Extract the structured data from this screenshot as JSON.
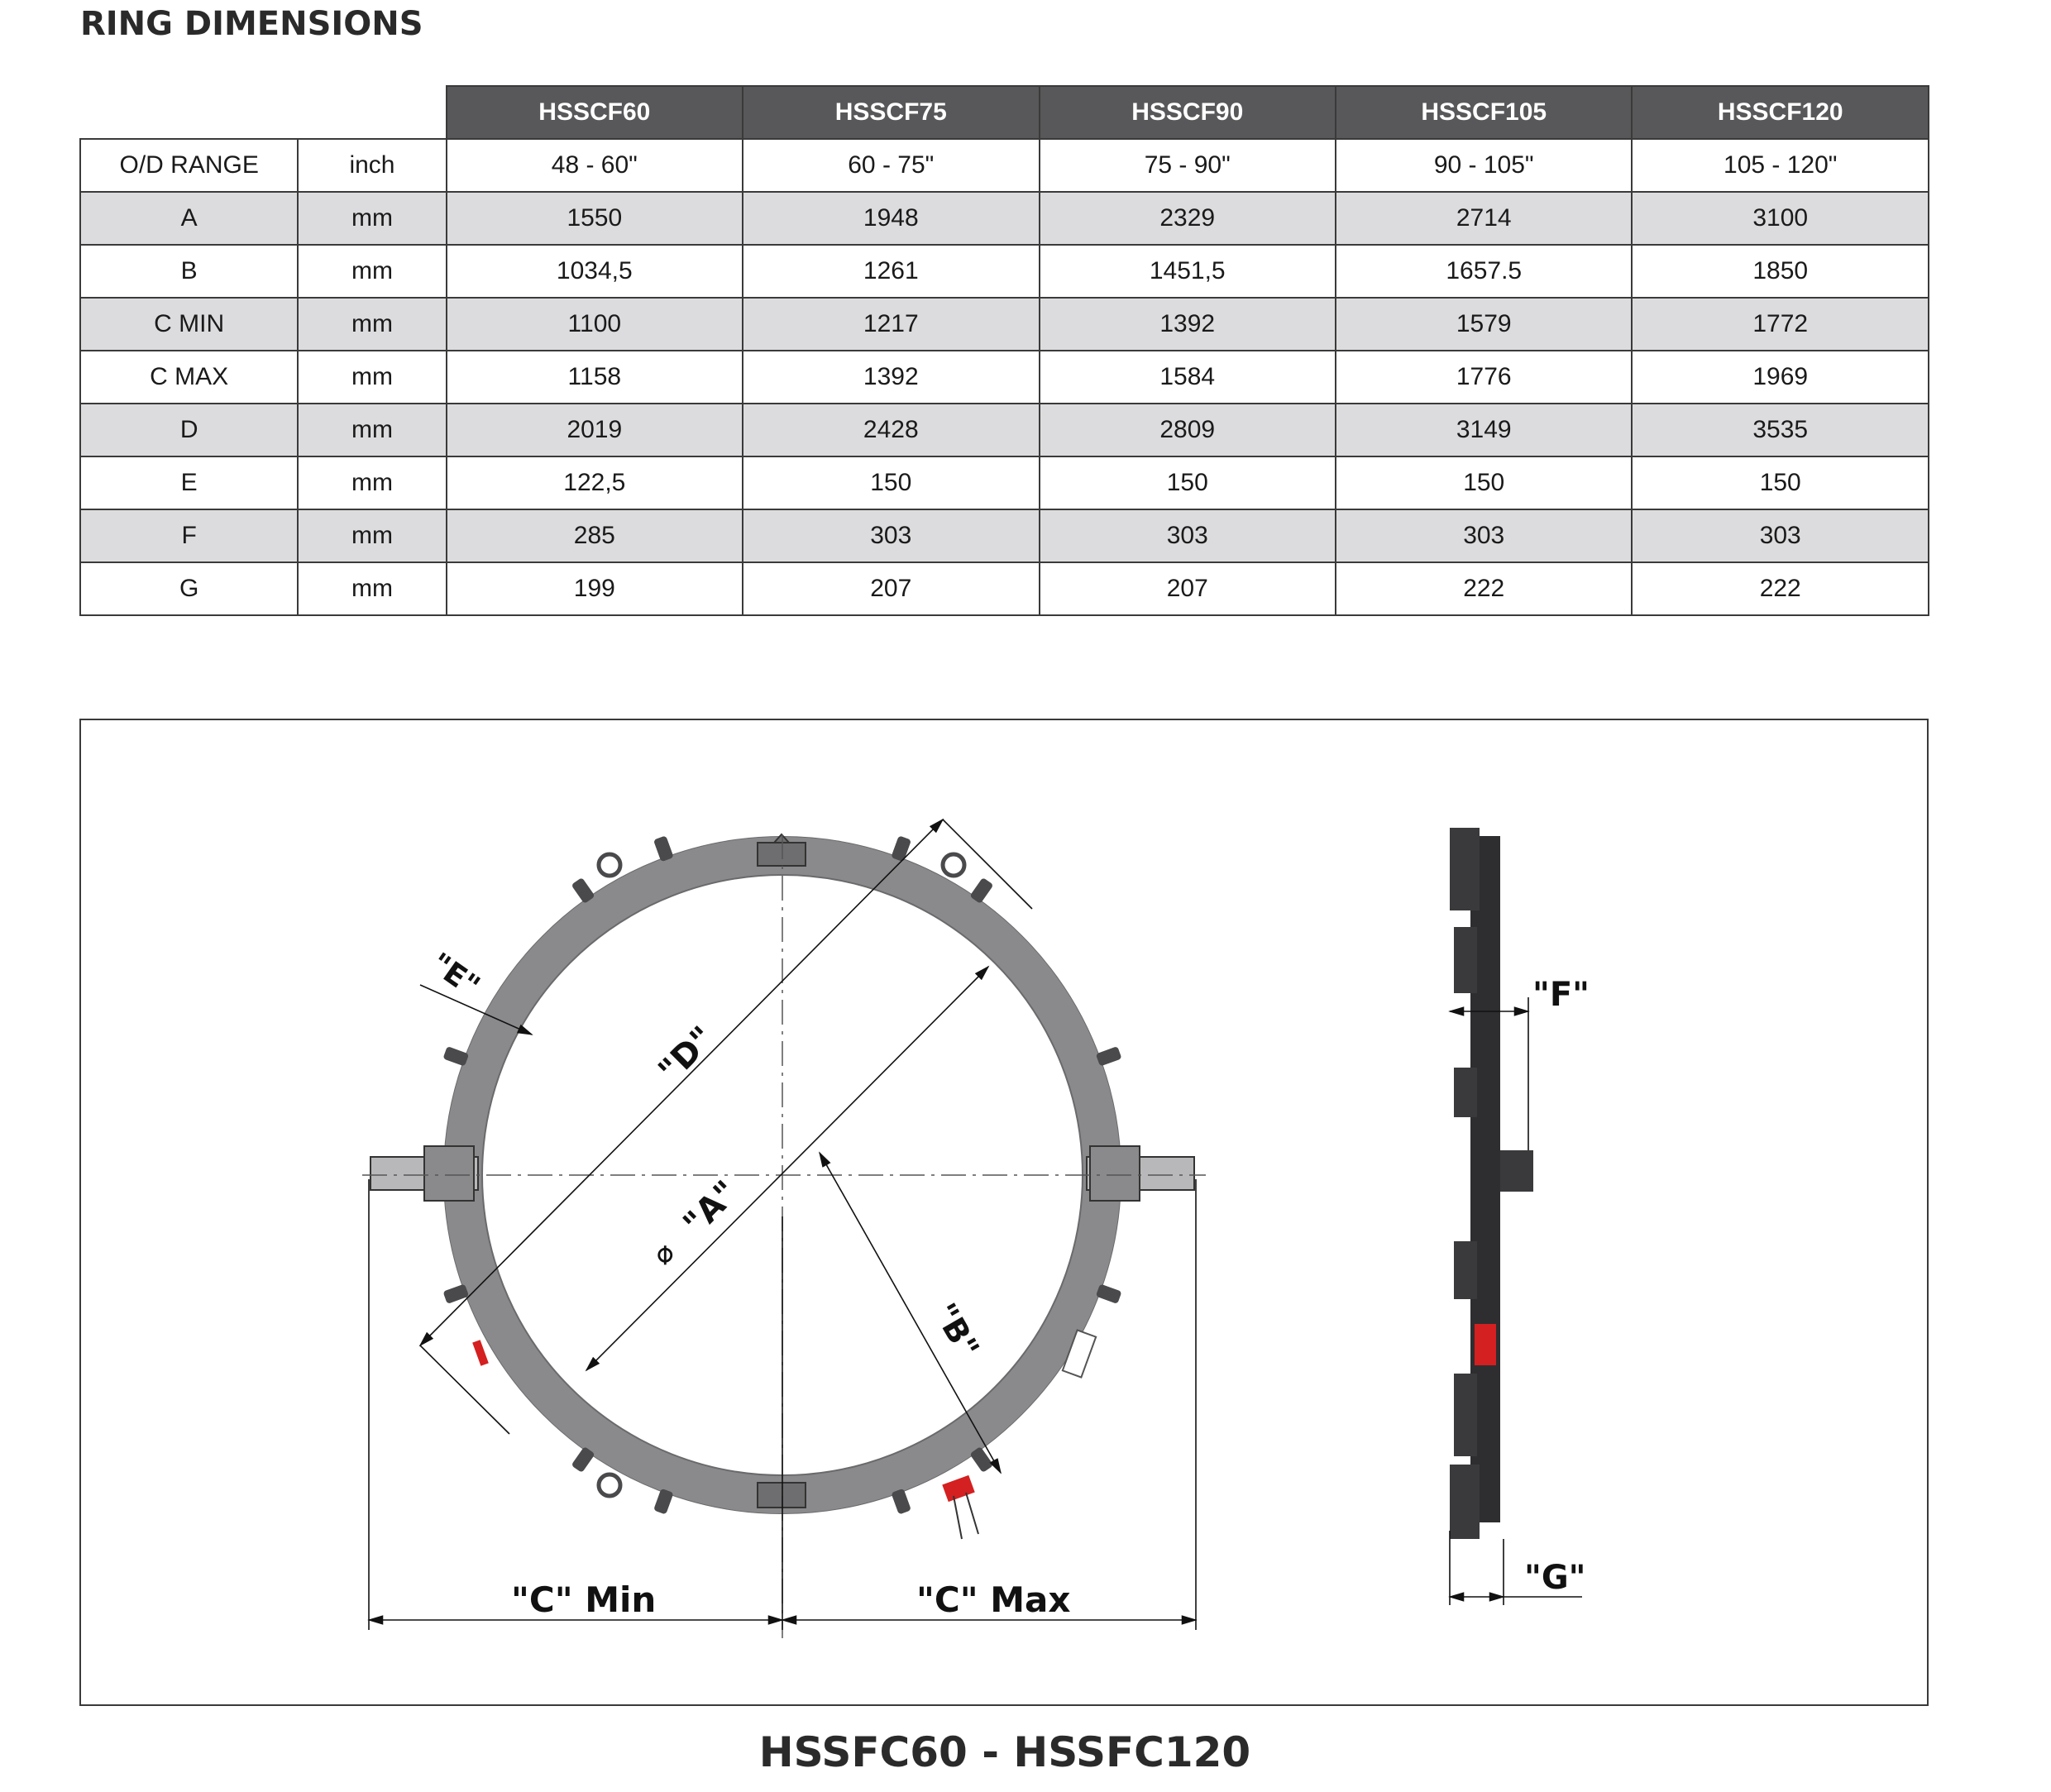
{
  "page": {
    "title": "RING DIMENSIONS",
    "caption": "HSSFC60 - HSSFC120"
  },
  "table": {
    "models": [
      "HSSCF60",
      "HSSCF75",
      "HSSCF90",
      "HSSCF105",
      "HSSCF120"
    ],
    "rows": [
      {
        "label": "O/D RANGE",
        "unit": "inch",
        "values": [
          "48 - 60\"",
          "60 - 75\"",
          "75 - 90\"",
          "90 - 105\"",
          "105 - 120\""
        ]
      },
      {
        "label": "A",
        "unit": "mm",
        "values": [
          "1550",
          "1948",
          "2329",
          "2714",
          "3100"
        ]
      },
      {
        "label": "B",
        "unit": "mm",
        "values": [
          "1034,5",
          "1261",
          "1451,5",
          "1657.5",
          "1850"
        ]
      },
      {
        "label": "C MIN",
        "unit": "mm",
        "values": [
          "1100",
          "1217",
          "1392",
          "1579",
          "1772"
        ]
      },
      {
        "label": "C MAX",
        "unit": "mm",
        "values": [
          "1158",
          "1392",
          "1584",
          "1776",
          "1969"
        ]
      },
      {
        "label": "D",
        "unit": "mm",
        "values": [
          "2019",
          "2428",
          "2809",
          "3149",
          "3535"
        ]
      },
      {
        "label": "E",
        "unit": "mm",
        "values": [
          "122,5",
          "150",
          "150",
          "150",
          "150"
        ]
      },
      {
        "label": "F",
        "unit": "mm",
        "values": [
          "285",
          "303",
          "303",
          "303",
          "303"
        ]
      },
      {
        "label": "G",
        "unit": "mm",
        "values": [
          "199",
          "207",
          "207",
          "222",
          "222"
        ]
      }
    ]
  },
  "drawing": {
    "labels": {
      "d": "\"D\"",
      "a": "\"A\"",
      "b": "\"B\"",
      "e": "\"E\"",
      "f": "\"F\"",
      "g": "\"G\"",
      "c_min": "\"C\" Min",
      "c_max": "\"C\" Max",
      "diameter_symbol": "⌀"
    },
    "colors": {
      "ring": "#8a8a8c",
      "ring_edge": "#5a5a5c",
      "side_view": "#2e2e30",
      "accent_red": "#d42020"
    }
  }
}
